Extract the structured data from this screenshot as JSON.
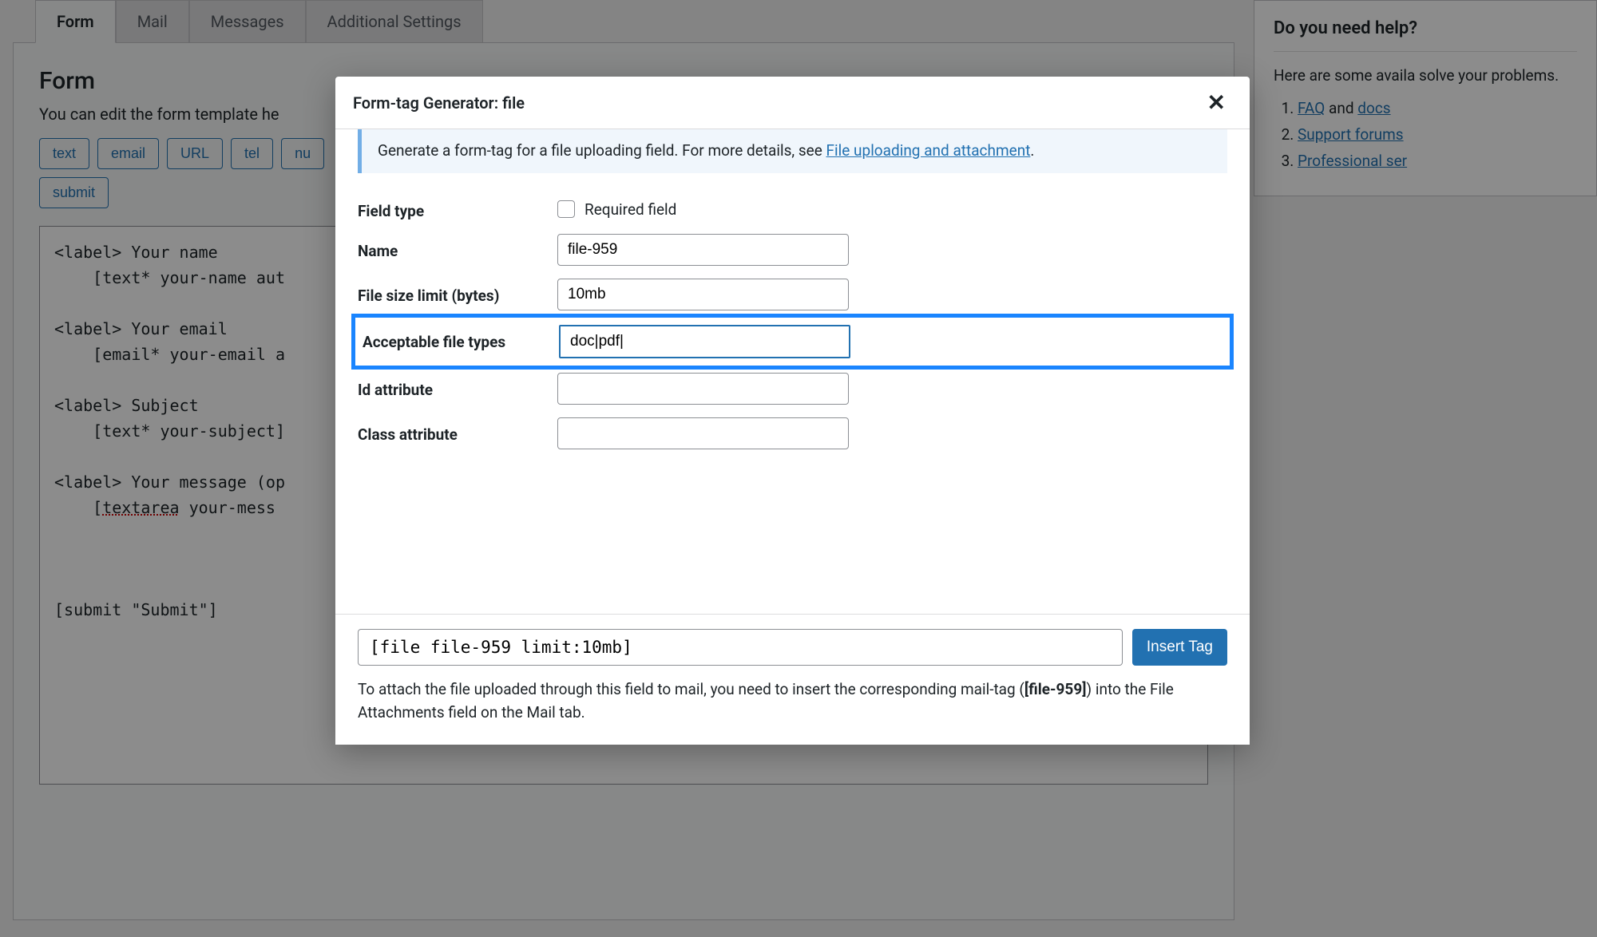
{
  "tabs": {
    "form": "Form",
    "mail": "Mail",
    "messages": "Messages",
    "additional": "Additional Settings"
  },
  "panel": {
    "heading": "Form",
    "desc": "You can edit the form template he",
    "buttons": [
      "text",
      "email",
      "URL",
      "tel",
      "nu",
      "submit"
    ],
    "code": "<label> Your name\n    [text* your-name aut\n\n<label> Your email\n    [email* your-email a\n\n<label> Subject\n    [text* your-subject]\n\n<label> Your message (op\n    [textarea your-mess\n\n\n\n[submit \"Submit\"]"
  },
  "sidebar": {
    "heading": "Do you need help?",
    "intro": "Here are some availa solve your problems.",
    "links": {
      "faq": "FAQ",
      "and": " and ",
      "docs": "docs",
      "support": "Support forums",
      "pro": "Professional ser"
    }
  },
  "modal": {
    "title": "Form-tag Generator: file",
    "info_pre": "Generate a form-tag for a file uploading field. For more details, see ",
    "info_link": "File uploading and attachment",
    "info_post": ".",
    "labels": {
      "field_type": "Field type",
      "required": "Required field",
      "name": "Name",
      "size": "File size limit (bytes)",
      "types": "Acceptable file types",
      "id": "Id attribute",
      "class": "Class attribute"
    },
    "values": {
      "name": "file-959",
      "size": "10mb",
      "types": "doc|pdf|",
      "id": "",
      "class": ""
    },
    "output": "[file file-959 limit:10mb]",
    "insert": "Insert Tag",
    "foot_pre": "To attach the file uploaded through this field to mail, you need to insert the corresponding mail-tag (",
    "foot_tag": "[file-959]",
    "foot_post": ") into the File Attachments field on the Mail tab."
  }
}
